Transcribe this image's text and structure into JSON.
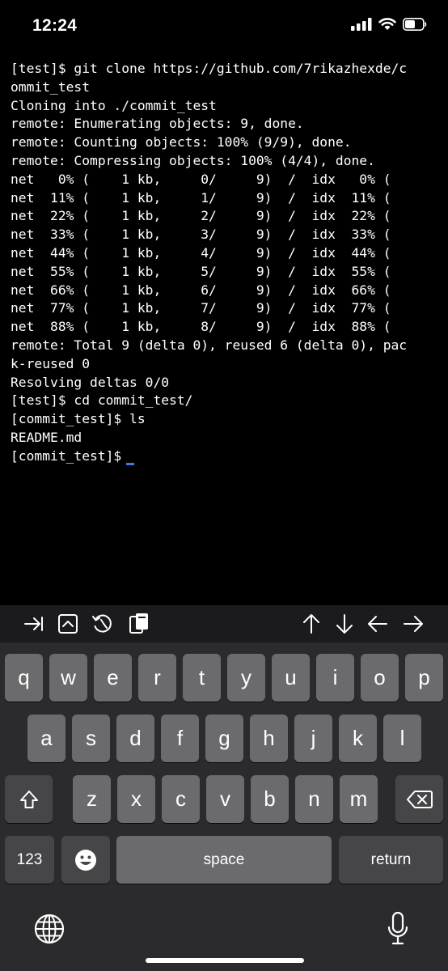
{
  "status_bar": {
    "time": "12:24"
  },
  "terminal": {
    "lines": [
      "[test]$ git clone https://github.com/7rikazhexde/c",
      "ommit_test",
      "Cloning into ./commit_test",
      "remote: Enumerating objects: 9, done.",
      "remote: Counting objects: 100% (9/9), done.",
      "remote: Compressing objects: 100% (4/4), done.",
      "net   0% (    1 kb,     0/     9)  /  idx   0% (",
      "net  11% (    1 kb,     1/     9)  /  idx  11% (",
      "net  22% (    1 kb,     2/     9)  /  idx  22% (",
      "net  33% (    1 kb,     3/     9)  /  idx  33% (",
      "net  44% (    1 kb,     4/     9)  /  idx  44% (",
      "net  55% (    1 kb,     5/     9)  /  idx  55% (",
      "net  66% (    1 kb,     6/     9)  /  idx  66% (",
      "net  77% (    1 kb,     7/     9)  /  idx  77% (",
      "net  88% (    1 kb,     8/     9)  /  idx  88% (",
      "remote: Total 9 (delta 0), reused 6 (delta 0), pac",
      "k-reused 0",
      "Resolving deltas 0/0",
      "[test]$ cd commit_test/",
      "[commit_test]$ ls",
      "README.md"
    ],
    "prompt": "[commit_test]$"
  },
  "toolbar": {
    "left_icons": [
      "tab-icon",
      "escape-icon",
      "history-icon",
      "clipboard-icon"
    ],
    "right_icons": [
      "arrow-up-icon",
      "arrow-down-icon",
      "arrow-left-icon",
      "arrow-right-icon"
    ]
  },
  "keyboard": {
    "row1": [
      "q",
      "w",
      "e",
      "r",
      "t",
      "y",
      "u",
      "i",
      "o",
      "p"
    ],
    "row2": [
      "a",
      "s",
      "d",
      "f",
      "g",
      "h",
      "j",
      "k",
      "l"
    ],
    "row3": [
      "z",
      "x",
      "c",
      "v",
      "b",
      "n",
      "m"
    ],
    "numbers_label": "123",
    "space_label": "space",
    "return_label": "return"
  },
  "colors": {
    "cursor": "#3f7be8",
    "key": "#6b6b6d",
    "key_dark": "#464648",
    "keyboard_bg": "#2b2b2d"
  }
}
